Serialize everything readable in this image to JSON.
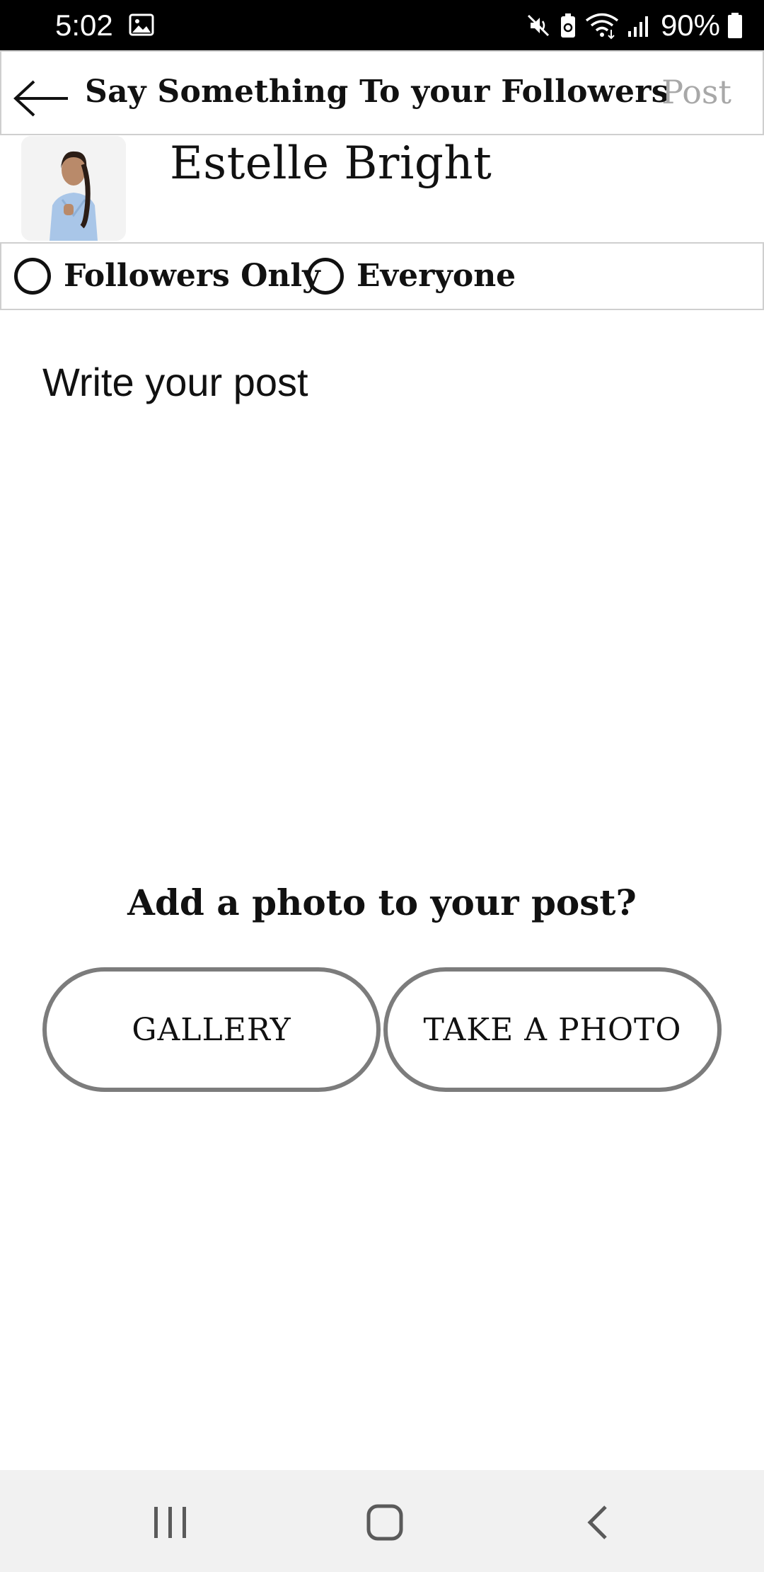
{
  "status_bar": {
    "time": "5:02",
    "battery": "90%",
    "icons": [
      "gallery-icon",
      "mute-icon",
      "battery-saver-icon",
      "wifi-icon",
      "signal-icon",
      "battery-icon"
    ]
  },
  "header": {
    "back_icon": "arrow-left-icon",
    "title": "Say Something To your Followers",
    "post_label": "Post"
  },
  "profile": {
    "name": "Estelle Bright"
  },
  "visibility": {
    "options": [
      {
        "label": "Followers Only",
        "selected": false
      },
      {
        "label": "Everyone",
        "selected": false
      }
    ]
  },
  "post": {
    "placeholder": "Write your post"
  },
  "photo": {
    "prompt": "Add a photo to your post?",
    "gallery_label": "GALLERY",
    "camera_label": "TAKE A PHOTO"
  },
  "nav": {
    "icons": [
      "recents-icon",
      "home-icon",
      "back-icon"
    ]
  },
  "colors": {
    "status_bar_bg": "#000000",
    "post_disabled": "#a8a8a8",
    "button_border": "#7c7c7c",
    "nav_bg": "#f1f1f1"
  }
}
